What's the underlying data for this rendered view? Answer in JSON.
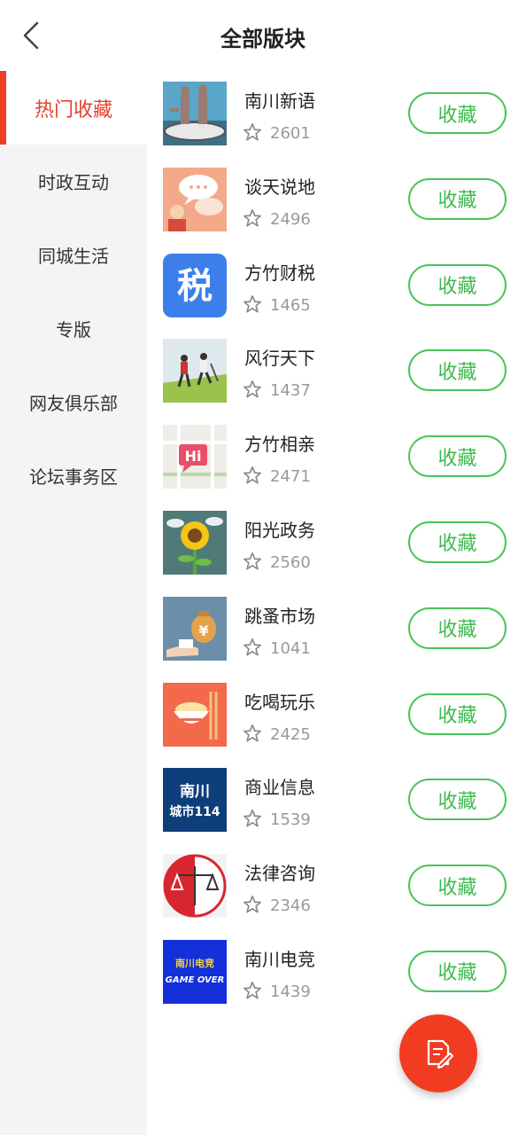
{
  "header": {
    "title": "全部版块"
  },
  "sidebar": {
    "items": [
      {
        "label": "热门收藏"
      },
      {
        "label": "时政互动"
      },
      {
        "label": "同城生活"
      },
      {
        "label": "专版"
      },
      {
        "label": "网友俱乐部"
      },
      {
        "label": "论坛事务区"
      }
    ]
  },
  "boards": [
    {
      "name": "南川新语",
      "count": "2601",
      "button": "收藏",
      "icon": "statue-icon"
    },
    {
      "name": "谈天说地",
      "count": "2496",
      "button": "收藏",
      "icon": "chat-bubble-icon"
    },
    {
      "name": "方竹财税",
      "count": "1465",
      "button": "收藏",
      "icon": "tax-icon"
    },
    {
      "name": "风行天下",
      "count": "1437",
      "button": "收藏",
      "icon": "hikers-icon"
    },
    {
      "name": "方竹相亲",
      "count": "2471",
      "button": "收藏",
      "icon": "hi-map-icon"
    },
    {
      "name": "阳光政务",
      "count": "2560",
      "button": "收藏",
      "icon": "sunflower-icon"
    },
    {
      "name": "跳蚤市场",
      "count": "1041",
      "button": "收藏",
      "icon": "money-bag-icon"
    },
    {
      "name": "吃喝玩乐",
      "count": "2425",
      "button": "收藏",
      "icon": "food-bowl-icon"
    },
    {
      "name": "商业信息",
      "count": "1539",
      "button": "收藏",
      "icon": "city-114-icon"
    },
    {
      "name": "法律咨询",
      "count": "2346",
      "button": "收藏",
      "icon": "scales-icon"
    },
    {
      "name": "南川电竞",
      "count": "1439",
      "button": "收藏",
      "icon": "game-over-icon"
    }
  ],
  "thumb_text": {
    "tax": "税",
    "hi": "Hi",
    "money": "¥",
    "city1": "南川",
    "city2": "城市114",
    "esports1": "南川电竞",
    "esports2": "GAME OVER"
  },
  "colors": {
    "accent_red": "#f03d25",
    "button_green": "#3dbb4e",
    "sidebar_bg": "#f4f4f4"
  }
}
